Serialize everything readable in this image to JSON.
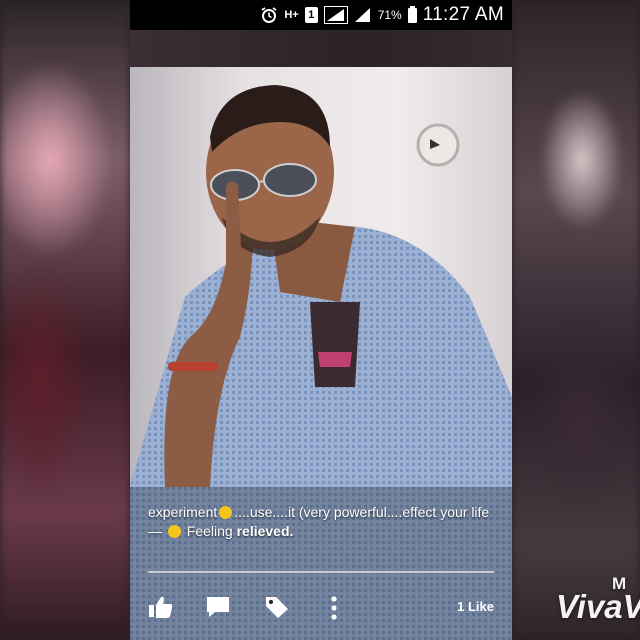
{
  "status_bar": {
    "network_label": "H+",
    "sim_label": "1",
    "battery_percent": "71%",
    "time": "11:27 AM",
    "icons": [
      "alarm-icon",
      "network-icon",
      "sim-icon",
      "signal-icon",
      "signal-icon",
      "battery-icon"
    ]
  },
  "post": {
    "caption": {
      "part1": "experiment",
      "part2": "....use....it (very powerful....effect your life — ",
      "part3": "Feeling",
      "feeling": "relieved."
    },
    "actions": {
      "like_icon": "thumbs-up-icon",
      "comment_icon": "comment-icon",
      "tag_icon": "tag-icon",
      "more_icon": "more-vertical-icon",
      "like_count": "1 Like"
    }
  },
  "watermark": {
    "top": "M",
    "main": "VivaV"
  }
}
